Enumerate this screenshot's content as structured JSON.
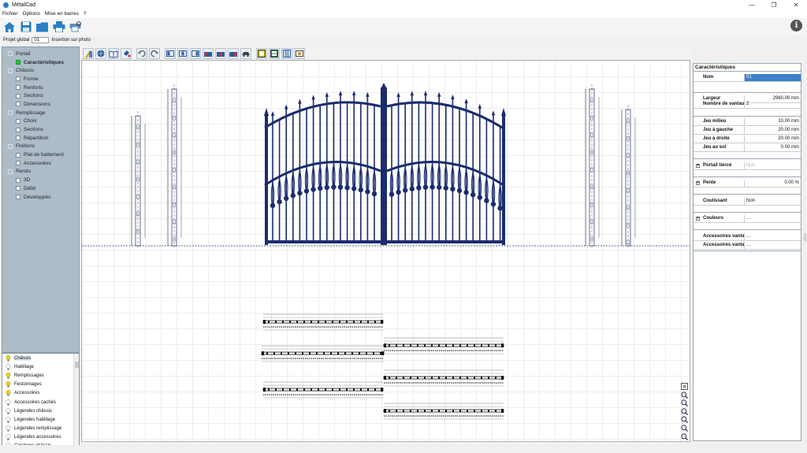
{
  "app": {
    "title": "MétalCad"
  },
  "window_controls": {
    "minimize": "—",
    "maximize": "❐",
    "close": "✕"
  },
  "menu": [
    "Fichier",
    "Options",
    "Mise en barres",
    "?"
  ],
  "toolbar_icons": [
    "home-icon",
    "save-icon",
    "open-folder-icon",
    "print-icon",
    "print-preview-icon"
  ],
  "info_label": "i",
  "project": {
    "label": "Projet global",
    "value": "01",
    "photo_button": "Insertion sur photo"
  },
  "tree": [
    {
      "label": "Portail",
      "level": 0,
      "check": "hollow"
    },
    {
      "label": "Caractéristiques",
      "level": 1,
      "check": "green",
      "active": true
    },
    {
      "label": "Châssis",
      "level": 0,
      "check": "hollow"
    },
    {
      "label": "Forme",
      "level": 1,
      "check": "white"
    },
    {
      "label": "Renforts",
      "level": 1,
      "check": "white"
    },
    {
      "label": "Sections",
      "level": 1,
      "check": "white"
    },
    {
      "label": "Dimensions",
      "level": 1,
      "check": "white"
    },
    {
      "label": "Remplissage",
      "level": 0,
      "check": "hollow"
    },
    {
      "label": "Choix",
      "level": 1,
      "check": "white"
    },
    {
      "label": "Sections",
      "level": 1,
      "check": "white"
    },
    {
      "label": "Répartition",
      "level": 1,
      "check": "white"
    },
    {
      "label": "Finitions",
      "level": 0,
      "check": "hollow"
    },
    {
      "label": "Plat de battement",
      "level": 1,
      "check": "white"
    },
    {
      "label": "Accessoires",
      "level": 1,
      "check": "white"
    },
    {
      "label": "Rendu",
      "level": 0,
      "check": "hollow"
    },
    {
      "label": "3D",
      "level": 1,
      "check": "white"
    },
    {
      "label": "Débit",
      "level": 1,
      "check": "white"
    },
    {
      "label": "Développés",
      "level": 1,
      "check": "white"
    }
  ],
  "layers": [
    {
      "label": "Châssis",
      "on": true,
      "selected": true
    },
    {
      "label": "Habillage",
      "on": false
    },
    {
      "label": "Remplissages",
      "on": true
    },
    {
      "label": "Festonnages",
      "on": true
    },
    {
      "label": "Accessoires",
      "on": true
    },
    {
      "label": "Accessoires cachés",
      "on": false
    },
    {
      "label": "Légendes châssis",
      "on": false
    },
    {
      "label": "Légendes habillage",
      "on": false
    },
    {
      "label": "Légendes remplissage",
      "on": false
    },
    {
      "label": "Légendes accessoires",
      "on": false
    },
    {
      "label": "Cotations châssis",
      "on": false
    }
  ],
  "drawing_tools": [
    "pencil-ruler-icon",
    "globe-icon",
    "book-icon",
    "fill-icon",
    "undo-icon",
    "redo-icon",
    "left-panel-icon",
    "center-panel-icon",
    "right-panel-icon",
    "left-gate-icon",
    "double-gate-icon",
    "right-gate-icon",
    "vehicle-icon",
    "frame-icon",
    "split-frame-icon",
    "bars-icon",
    "photo-icon"
  ],
  "zoom_tools": [
    "zoom-extents-icon",
    "zoom-window-icon",
    "zoom-in-icon",
    "zoom-out-icon",
    "zoom-previous-icon",
    "zoom-reset-icon",
    "zoom-pan-icon"
  ],
  "properties": {
    "header": "Caractéristiques",
    "rows": [
      {
        "key": "Nom",
        "value": "01",
        "style": "sel"
      },
      {
        "key": "Largeur",
        "value": "2960.00 mm",
        "style": "right"
      },
      {
        "key": "Nombre de vantaux",
        "value": "2",
        "style": ""
      },
      {
        "key": "Jeu milieu",
        "value": "10.00 mm",
        "style": "right"
      },
      {
        "key": "Jeu à gauche",
        "value": "20.00 mm",
        "style": "right"
      },
      {
        "key": "Jeu à droite",
        "value": "20.00 mm",
        "style": "right"
      },
      {
        "key": "Jeu au sol",
        "value": "0.00 mm",
        "style": "right"
      },
      {
        "key": "Portail tiercé",
        "value": "Non",
        "style": "grey",
        "expand": true
      },
      {
        "key": "Pente",
        "value": "0.00 %",
        "style": "right",
        "expand": true
      },
      {
        "key": "Coulissant",
        "value": "Non",
        "style": ""
      },
      {
        "key": "Couleurs",
        "value": "...",
        "style": "",
        "expand": true
      },
      {
        "key": "Accessoires vantail gauche",
        "value": "...",
        "style": ""
      },
      {
        "key": "Accessoires vantail droit",
        "value": "...",
        "style": ""
      }
    ]
  },
  "colors": {
    "gate": "#1b2c6f",
    "tree_bg": "#aebcc7",
    "selection": "#3f7fcc",
    "check_on": "#22cc33",
    "bulb_on": "#f5d400"
  }
}
